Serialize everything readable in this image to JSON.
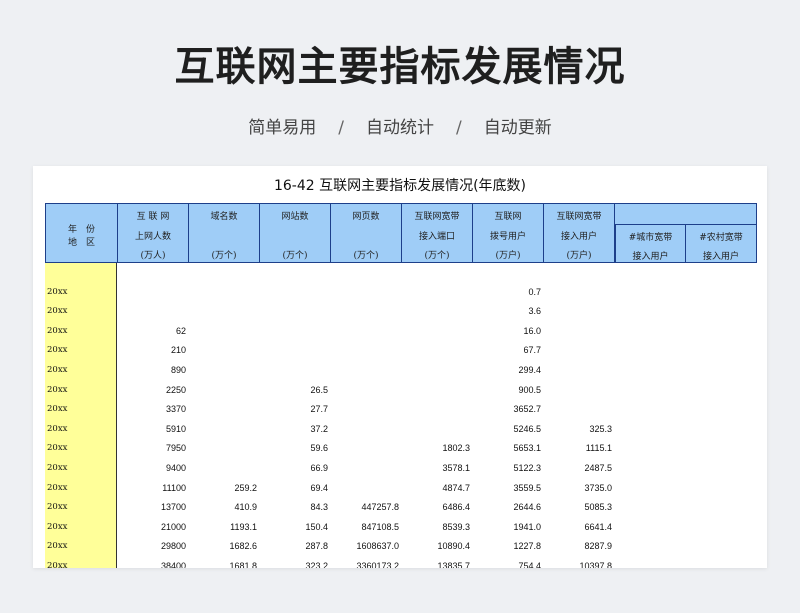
{
  "hero": {
    "title": "互联网主要指标发展情况",
    "tags": [
      "简单易用",
      "自动统计",
      "自动更新"
    ],
    "separator": "/"
  },
  "sheet": {
    "title": "16-42    互联网主要指标发展情况(年底数)",
    "headers": {
      "year_region": [
        "年　份",
        "地　区"
      ],
      "users": [
        "互 联 网",
        "上网人数",
        "(万人)"
      ],
      "domains": [
        "域名数",
        "(万个)"
      ],
      "sites": [
        "网站数",
        "(万个)"
      ],
      "pages": [
        "网页数",
        "(万个)"
      ],
      "broadband_ports": [
        "互联网宽带",
        "接入端口",
        "(万个)"
      ],
      "dialup": [
        "互联网",
        "拨号用户",
        "(万户)"
      ],
      "broadband_users": [
        "互联网宽带",
        "接入用户",
        "(万户)"
      ],
      "urban": [
        "#城市宽带",
        "接入用户"
      ],
      "rural": [
        "#农村宽带",
        "接入用户"
      ]
    },
    "rows": [
      {
        "year": "",
        "users": "",
        "domains": "",
        "sites": "",
        "pages": "",
        "ports": "",
        "dialup": "",
        "bb": ""
      },
      {
        "year": "20xx",
        "users": "",
        "domains": "",
        "sites": "",
        "pages": "",
        "ports": "",
        "dialup": "0.7",
        "bb": ""
      },
      {
        "year": "20xx",
        "users": "",
        "domains": "",
        "sites": "",
        "pages": "",
        "ports": "",
        "dialup": "3.6",
        "bb": ""
      },
      {
        "year": "20xx",
        "users": "62",
        "domains": "",
        "sites": "",
        "pages": "",
        "ports": "",
        "dialup": "16.0",
        "bb": ""
      },
      {
        "year": "20xx",
        "users": "210",
        "domains": "",
        "sites": "",
        "pages": "",
        "ports": "",
        "dialup": "67.7",
        "bb": ""
      },
      {
        "year": "20xx",
        "users": "890",
        "domains": "",
        "sites": "",
        "pages": "",
        "ports": "",
        "dialup": "299.4",
        "bb": ""
      },
      {
        "year": "20xx",
        "users": "2250",
        "domains": "",
        "sites": "26.5",
        "pages": "",
        "ports": "",
        "dialup": "900.5",
        "bb": ""
      },
      {
        "year": "20xx",
        "users": "3370",
        "domains": "",
        "sites": "27.7",
        "pages": "",
        "ports": "",
        "dialup": "3652.7",
        "bb": ""
      },
      {
        "year": "20xx",
        "users": "5910",
        "domains": "",
        "sites": "37.2",
        "pages": "",
        "ports": "",
        "dialup": "5246.5",
        "bb": "325.3"
      },
      {
        "year": "20xx",
        "users": "7950",
        "domains": "",
        "sites": "59.6",
        "pages": "",
        "ports": "1802.3",
        "dialup": "5653.1",
        "bb": "1115.1"
      },
      {
        "year": "20xx",
        "users": "9400",
        "domains": "",
        "sites": "66.9",
        "pages": "",
        "ports": "3578.1",
        "dialup": "5122.3",
        "bb": "2487.5"
      },
      {
        "year": "20xx",
        "users": "11100",
        "domains": "259.2",
        "sites": "69.4",
        "pages": "",
        "ports": "4874.7",
        "dialup": "3559.5",
        "bb": "3735.0"
      },
      {
        "year": "20xx",
        "users": "13700",
        "domains": "410.9",
        "sites": "84.3",
        "pages": "447257.8",
        "ports": "6486.4",
        "dialup": "2644.6",
        "bb": "5085.3"
      },
      {
        "year": "20xx",
        "users": "21000",
        "domains": "1193.1",
        "sites": "150.4",
        "pages": "847108.5",
        "ports": "8539.3",
        "dialup": "1941.0",
        "bb": "6641.4"
      },
      {
        "year": "20xx",
        "users": "29800",
        "domains": "1682.6",
        "sites": "287.8",
        "pages": "1608637.0",
        "ports": "10890.4",
        "dialup": "1227.8",
        "bb": "8287.9"
      },
      {
        "year": "20xx",
        "users": "38400",
        "domains": "1681.8",
        "sites": "323.2",
        "pages": "3360173.2",
        "ports": "13835.7",
        "dialup": "754.4",
        "bb": "10397.8"
      }
    ]
  },
  "colors": {
    "header_bg": "#9fcdf7",
    "header_border": "#1d3f8a",
    "year_col_bg": "#ffff99",
    "page_bg": "#eef0f3"
  }
}
